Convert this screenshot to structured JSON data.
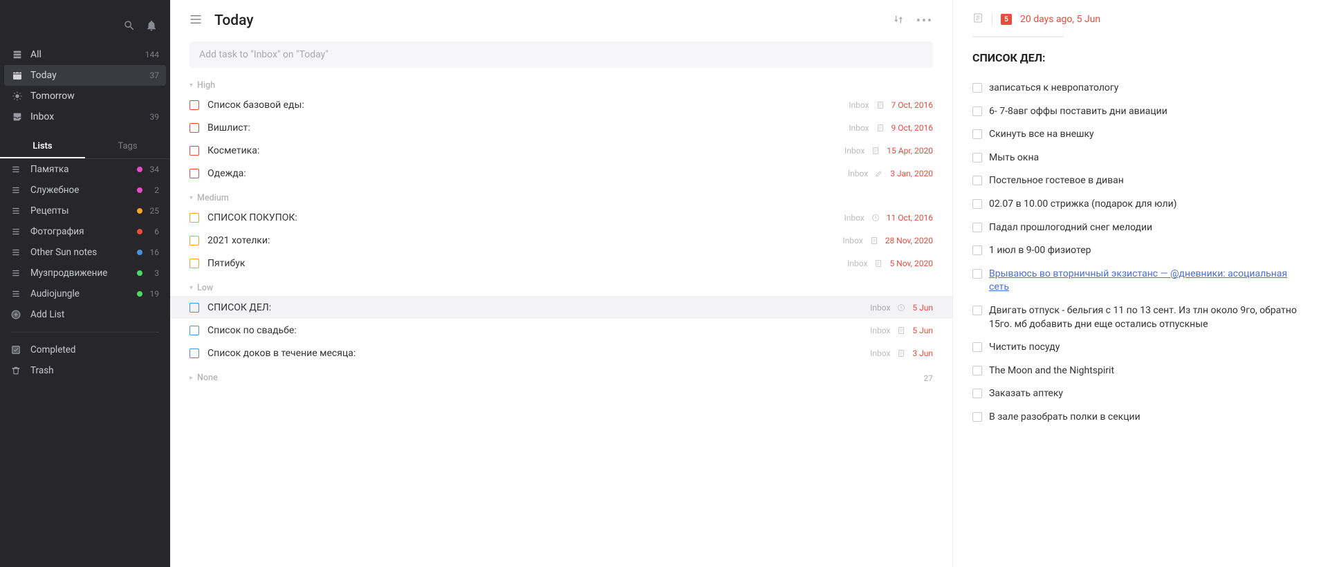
{
  "sidebar": {
    "nav": [
      {
        "id": "all",
        "label": "All",
        "count": "144"
      },
      {
        "id": "today",
        "label": "Today",
        "count": "37",
        "active": true
      },
      {
        "id": "tomorrow",
        "label": "Tomorrow",
        "count": ""
      },
      {
        "id": "inbox",
        "label": "Inbox",
        "count": "39"
      }
    ],
    "tabs": {
      "lists": "Lists",
      "tags": "Tags"
    },
    "lists": [
      {
        "label": "Памятка",
        "count": "34",
        "color": "#e84cca"
      },
      {
        "label": "Служебное",
        "count": "2",
        "color": "#e84cca"
      },
      {
        "label": "Рецепты",
        "count": "25",
        "color": "#f5a623"
      },
      {
        "label": "Фотография",
        "count": "6",
        "color": "#e84c3d"
      },
      {
        "label": "Other Sun notes",
        "count": "16",
        "color": "#4a90e2"
      },
      {
        "label": "Музпродвижение",
        "count": "3",
        "color": "#4cd964"
      },
      {
        "label": "Audiojungle",
        "count": "19",
        "color": "#4cd964"
      }
    ],
    "addList": "Add List",
    "completed": "Completed",
    "trash": "Trash"
  },
  "main": {
    "title": "Today",
    "addTaskPlaceholder": "Add task to \"Inbox\" on \"Today\"",
    "sections": {
      "high": {
        "label": "High",
        "tasks": [
          {
            "title": "Список базовой еды:",
            "folder": "Inbox",
            "date": "7 Oct, 2016",
            "check": "red",
            "icon": "doc"
          },
          {
            "title": "Вишлист:",
            "folder": "Inbox",
            "date": "9 Oct, 2016",
            "check": "red",
            "icon": "doc"
          },
          {
            "title": "Косметика:",
            "folder": "Inbox",
            "date": "15 Apr, 2020",
            "check": "red",
            "icon": "doc"
          },
          {
            "title": "Одежда:",
            "folder": "Inbox",
            "date": "3 Jan, 2020",
            "check": "red",
            "icon": "pen"
          }
        ]
      },
      "medium": {
        "label": "Medium",
        "tasks": [
          {
            "title": "СПИСОК ПОКУПОК:",
            "folder": "Inbox",
            "date": "11 Oct, 2016",
            "check": "orange",
            "icon": "clock"
          },
          {
            "title": "2021 хотелки:",
            "folder": "Inbox",
            "date": "28 Nov, 2020",
            "check": "orange",
            "icon": "doc"
          },
          {
            "title": "Пятибук",
            "folder": "Inbox",
            "date": "5 Nov, 2020",
            "check": "orange",
            "icon": "doc"
          }
        ]
      },
      "low": {
        "label": "Low",
        "tasks": [
          {
            "title": "СПИСОК ДЕЛ:",
            "folder": "Inbox",
            "date": "5 Jun",
            "check": "blue",
            "icon": "clock",
            "selected": true
          },
          {
            "title": "Список по свадьбе:",
            "folder": "Inbox",
            "date": "5 Jun",
            "check": "blue",
            "icon": "doc"
          },
          {
            "title": "Список доков в течение месяца:",
            "folder": "Inbox",
            "date": "3 Jun",
            "check": "blue",
            "icon": "doc"
          }
        ]
      },
      "none": {
        "label": "None",
        "count": "27"
      }
    }
  },
  "detail": {
    "calBadge": "5",
    "dateText": "20 days ago, 5 Jun",
    "heading": "СПИСОК ДЕЛ:",
    "items": [
      {
        "text": "записаться к невропатологу"
      },
      {
        "text": "6- 7-8авг оффы поставить дни авиации"
      },
      {
        "text": "Скинуть все на внешку"
      },
      {
        "text": "Мыть окна"
      },
      {
        "text": "Постельное гостевое в диван"
      },
      {
        "text": "02.07 в 10.00 стрижка (подарок для юли)"
      },
      {
        "text": "Падал прошлогодний снег мелодии"
      },
      {
        "text": "1 июл в 9-00 физиотер"
      },
      {
        "text": "Врываюсь во вторничный экзистанс  — @дневники: асоциальная сеть",
        "link": true
      },
      {
        "text": "Двигать отпуск - бельгия с 11 по 13 сент. Из тлн около 9го, обратно 15го. мб добавить дни еще остались отпускные"
      },
      {
        "text": "Чистить посуду"
      },
      {
        "text": "The Moon and the Nightspirit"
      },
      {
        "text": "Заказать аптеку"
      },
      {
        "text": "В зале разобрать полки в секции"
      }
    ]
  }
}
